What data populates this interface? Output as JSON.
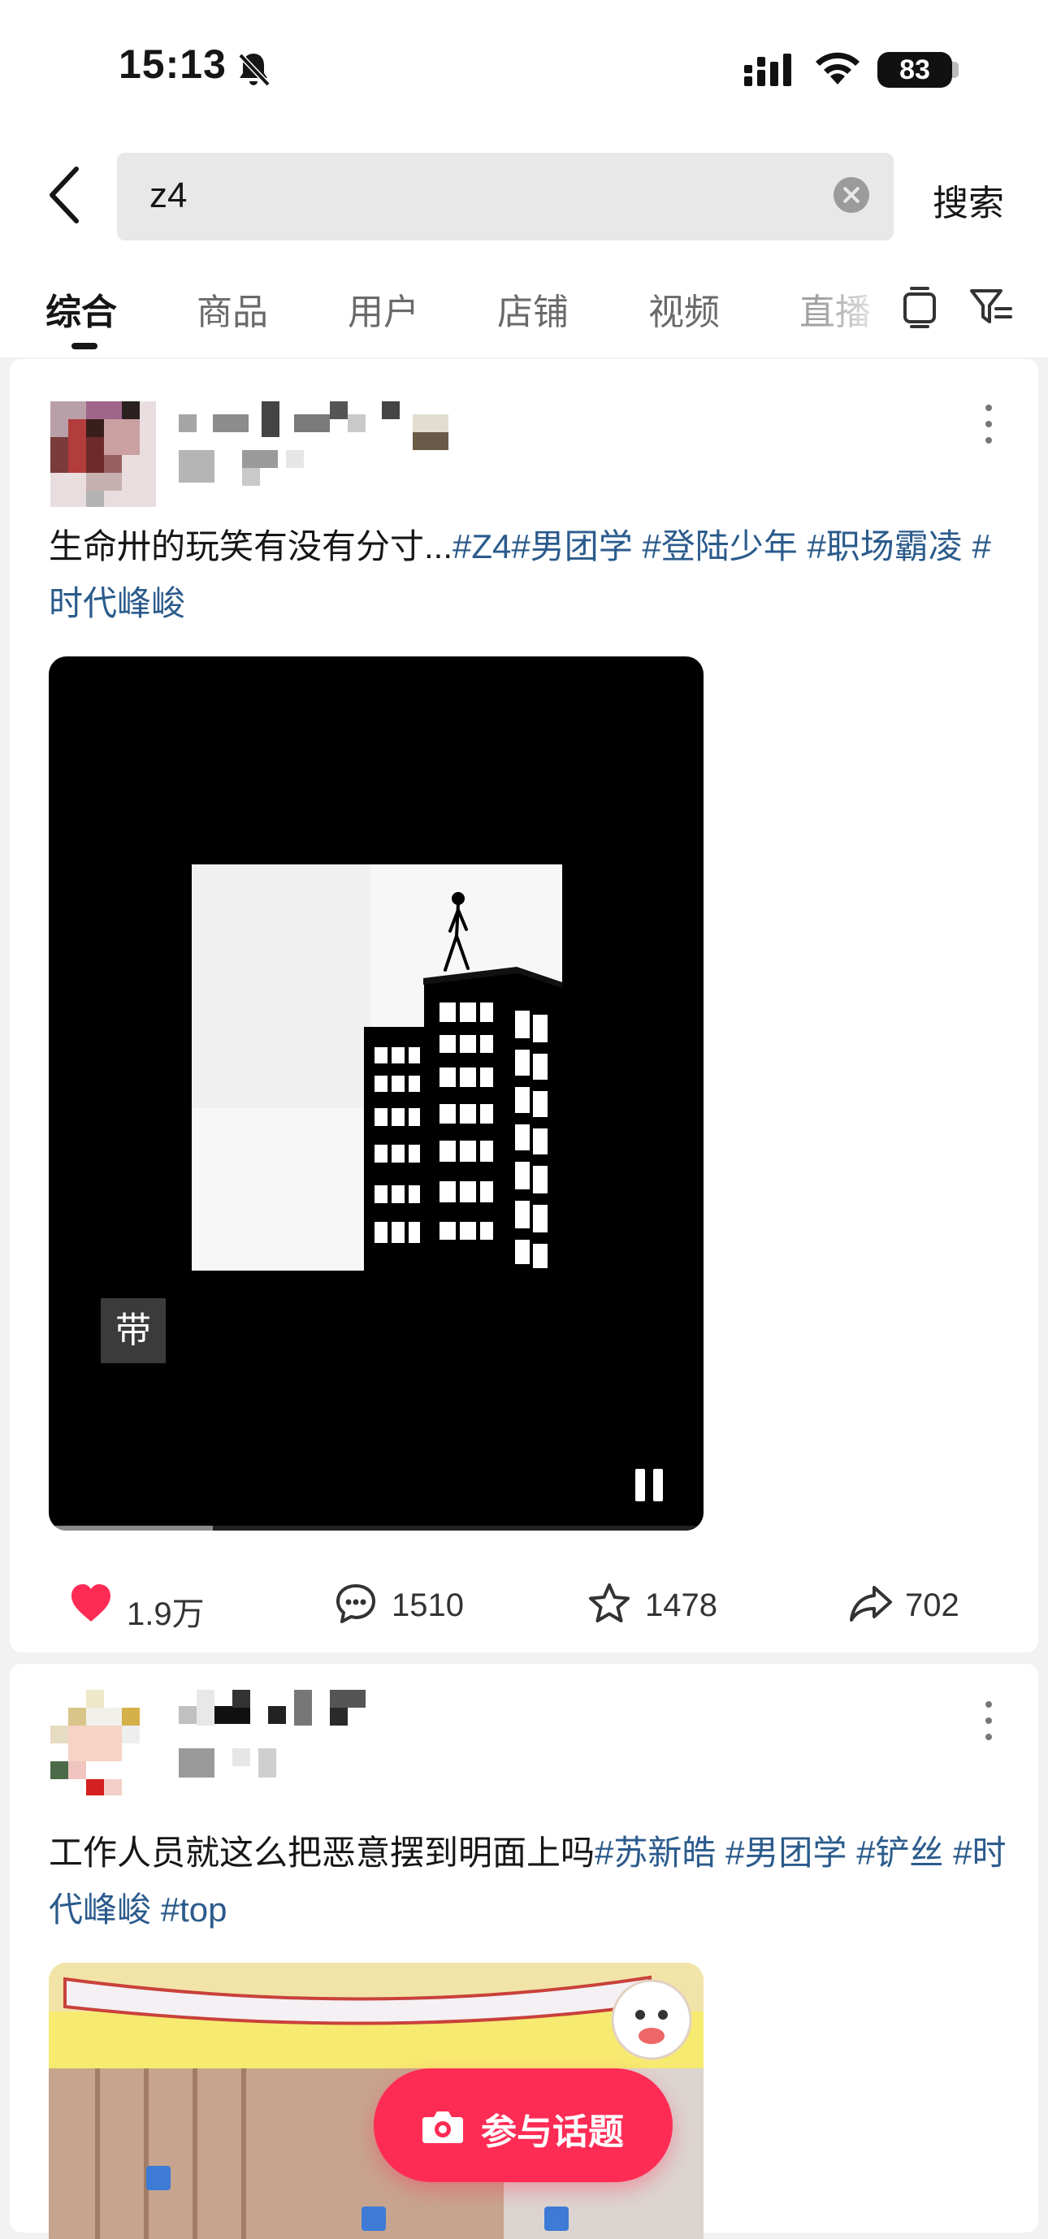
{
  "status_bar": {
    "time": "15:13",
    "battery": "83"
  },
  "search": {
    "query": "z4",
    "submit_label": "搜索"
  },
  "tabs": [
    {
      "label": "综合",
      "active": true
    },
    {
      "label": "商品"
    },
    {
      "label": "用户"
    },
    {
      "label": "店铺"
    },
    {
      "label": "视频"
    },
    {
      "label": "直播"
    }
  ],
  "posts": [
    {
      "caption_text": "生命卅的玩笑有没有分寸...",
      "tags": [
        "#Z4",
        "#男团学",
        "#登陆少年",
        "#职场霸凌",
        "#时代峰峻"
      ],
      "video": {
        "overlay_text": "带",
        "progress": 0.25,
        "playing": true
      },
      "stats": {
        "likes": "1.9万",
        "comments": "1510",
        "favorites": "1478",
        "shares": "702"
      }
    },
    {
      "caption_text": "工作人员就这么把恶意摆到明面上吗",
      "tags": [
        "#苏新皓",
        "#男团学",
        "#铲丝",
        "#时代峰峻",
        "#top"
      ]
    }
  ],
  "fab": {
    "label": "参与话题"
  },
  "colors": {
    "accent": "#fe2c55",
    "tag": "#2b5b8c",
    "like": "#fe2c55"
  }
}
